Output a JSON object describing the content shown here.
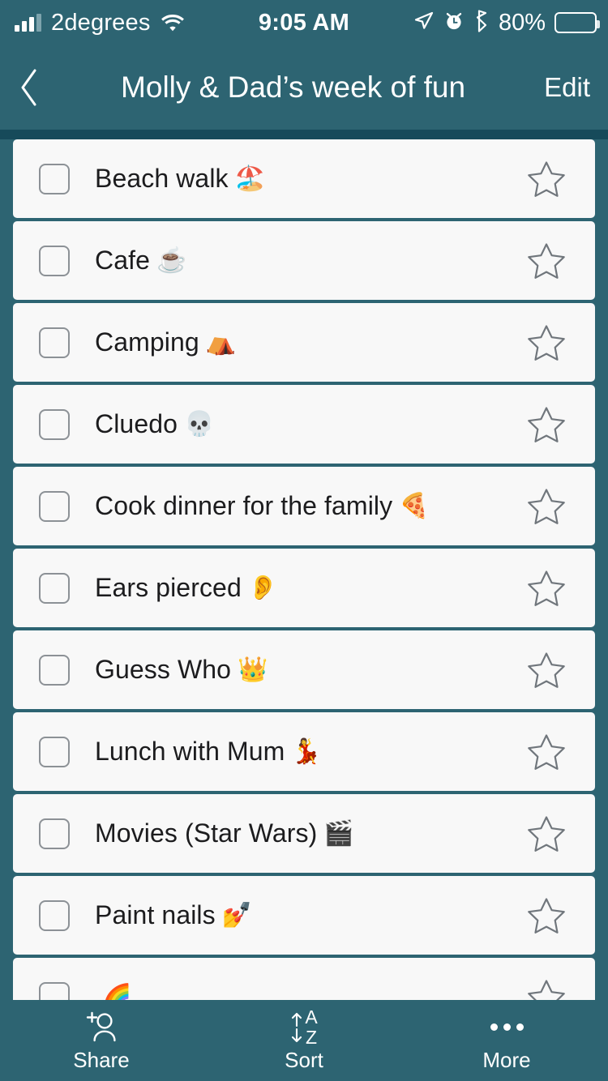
{
  "theme": {
    "accent_teal": "#2d6472",
    "divider_teal": "#164a5a",
    "card_bg": "#f8f8f8",
    "text_dark": "#1c1c1e",
    "outline_gray": "#8c9196",
    "star_gray": "#70767c"
  },
  "status_bar": {
    "carrier": "2degrees",
    "wifi_icon": "wifi-icon",
    "signal_icon": "signal-bars-icon",
    "time": "9:05 AM",
    "location_icon": "location-arrow-icon",
    "alarm_icon": "alarm-clock-icon",
    "bluetooth_icon": "bluetooth-icon",
    "battery_percent": "80%",
    "battery_level": 80,
    "battery_icon": "battery-icon"
  },
  "nav": {
    "back_icon": "chevron-left-icon",
    "title": "Molly & Dad’s week of fun",
    "edit_label": "Edit"
  },
  "list": {
    "checkbox_icon": "checkbox-unchecked-icon",
    "star_icon": "star-outline-icon",
    "items": [
      {
        "label": "Beach walk",
        "emoji": "🏖️",
        "emoji_name": "beach-with-umbrella-emoji",
        "checked": false,
        "starred": false
      },
      {
        "label": "Cafe",
        "emoji": "☕",
        "emoji_name": "hot-beverage-emoji",
        "checked": false,
        "starred": false
      },
      {
        "label": "Camping",
        "emoji": "⛺",
        "emoji_name": "tent-emoji",
        "checked": false,
        "starred": false
      },
      {
        "label": "Cluedo",
        "emoji": "💀",
        "emoji_name": "skull-emoji",
        "checked": false,
        "starred": false
      },
      {
        "label": "Cook dinner for the family",
        "emoji": "🍕",
        "emoji_name": "pizza-emoji",
        "checked": false,
        "starred": false
      },
      {
        "label": "Ears pierced",
        "emoji": "👂",
        "emoji_name": "ear-emoji",
        "checked": false,
        "starred": false
      },
      {
        "label": "Guess Who",
        "emoji": "👑",
        "emoji_name": "crown-emoji",
        "checked": false,
        "starred": false
      },
      {
        "label": "Lunch with Mum",
        "emoji": "💃",
        "emoji_name": "woman-dancing-emoji",
        "checked": false,
        "starred": false
      },
      {
        "label": "Movies (Star Wars)",
        "emoji": "🎬",
        "emoji_name": "clapper-board-emoji",
        "checked": false,
        "starred": false
      },
      {
        "label": "Paint nails",
        "emoji": "💅",
        "emoji_name": "nail-polish-emoji",
        "checked": false,
        "starred": false
      },
      {
        "label": "",
        "emoji": "🌈",
        "emoji_name": "rainbow-emoji",
        "checked": false,
        "starred": false
      }
    ]
  },
  "toolbar": {
    "items": [
      {
        "label": "Share",
        "icon": "add-person-icon"
      },
      {
        "label": "Sort",
        "icon": "sort-az-icon"
      },
      {
        "label": "More",
        "icon": "ellipsis-icon"
      }
    ]
  }
}
